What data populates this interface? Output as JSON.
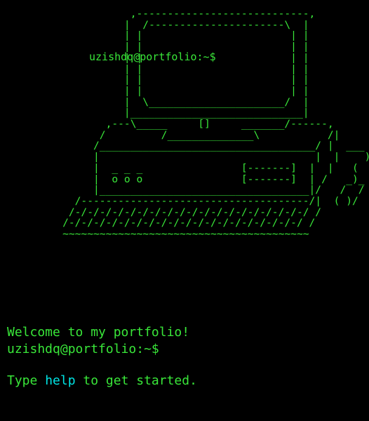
{
  "terminal": {
    "ascii_computer": "                    ,----------------------------,\n                   |  /----------------------\\  |\n                   | |                        | |\n                   | |                        | |\n                   | |                        | |\n                   | |                        | |\n                   | |                        | |\n                   | |                        | |\n                   |  \\______________________/  |\n                   |____________________________|\n                ,---\\_____     []     _______/------,\n               /         /______________\\           /|\n              /___________________________________/ |  ___\n              |                                   |  |    )\n              |  _ _ _                [-------]  |  |   (\n              |  o o o                [-------]  | /   _)_\n              |__________________________________|/   /  /\n           /-------------------------------------/|  ( )/\n          /-/-/-/-/-/-/-/-/-/-/-/-/-/-/-/-/-/-/-/ /\n         /-/-/-/-/-/-/-/-/-/-/-/-/-/-/-/-/-/-/-/ /\n         ~~~~~~~~~~~~~~~~~~~~~~~~~~~~~~~~~~~~~~~~",
    "screen_prompt": "uzishdq@portfolio:~$",
    "welcome_line": "Welcome to my portfolio!",
    "help_pre": "Type ",
    "help_cmd": "help",
    "help_post": " to get started.",
    "prompt": "uzishdq@portfolio:~$",
    "input_value": ""
  },
  "colors": {
    "background": "#000000",
    "text": "#39e639",
    "command_highlight": "#00e5e5"
  }
}
